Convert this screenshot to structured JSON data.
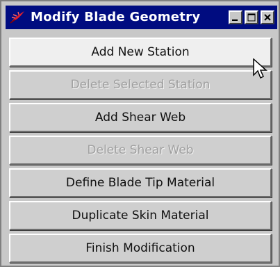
{
  "window": {
    "title": "Modify Blade Geometry",
    "icon": "tk-feather-icon",
    "controls": [
      "minimize-icon",
      "maximize-icon",
      "close-icon"
    ]
  },
  "buttons": [
    {
      "label": "Add New Station",
      "enabled": true,
      "state": "hover"
    },
    {
      "label": "Delete Selected Station",
      "enabled": false
    },
    {
      "label": "Add Shear Web",
      "enabled": true
    },
    {
      "label": "Delete Shear Web",
      "enabled": false
    },
    {
      "label": "Define Blade Tip Material",
      "enabled": true
    },
    {
      "label": "Duplicate Skin Material",
      "enabled": true
    },
    {
      "label": "Finish Modification",
      "enabled": true
    }
  ],
  "colors": {
    "titlebar": "#000c80",
    "title_text": "#ffffff",
    "button_face": "#cfcfcf",
    "button_hover": "#efefef",
    "disabled_text": "#a0a0a0",
    "tk_icon": "#e0202c"
  },
  "cursor": "mouse-pointer-icon"
}
